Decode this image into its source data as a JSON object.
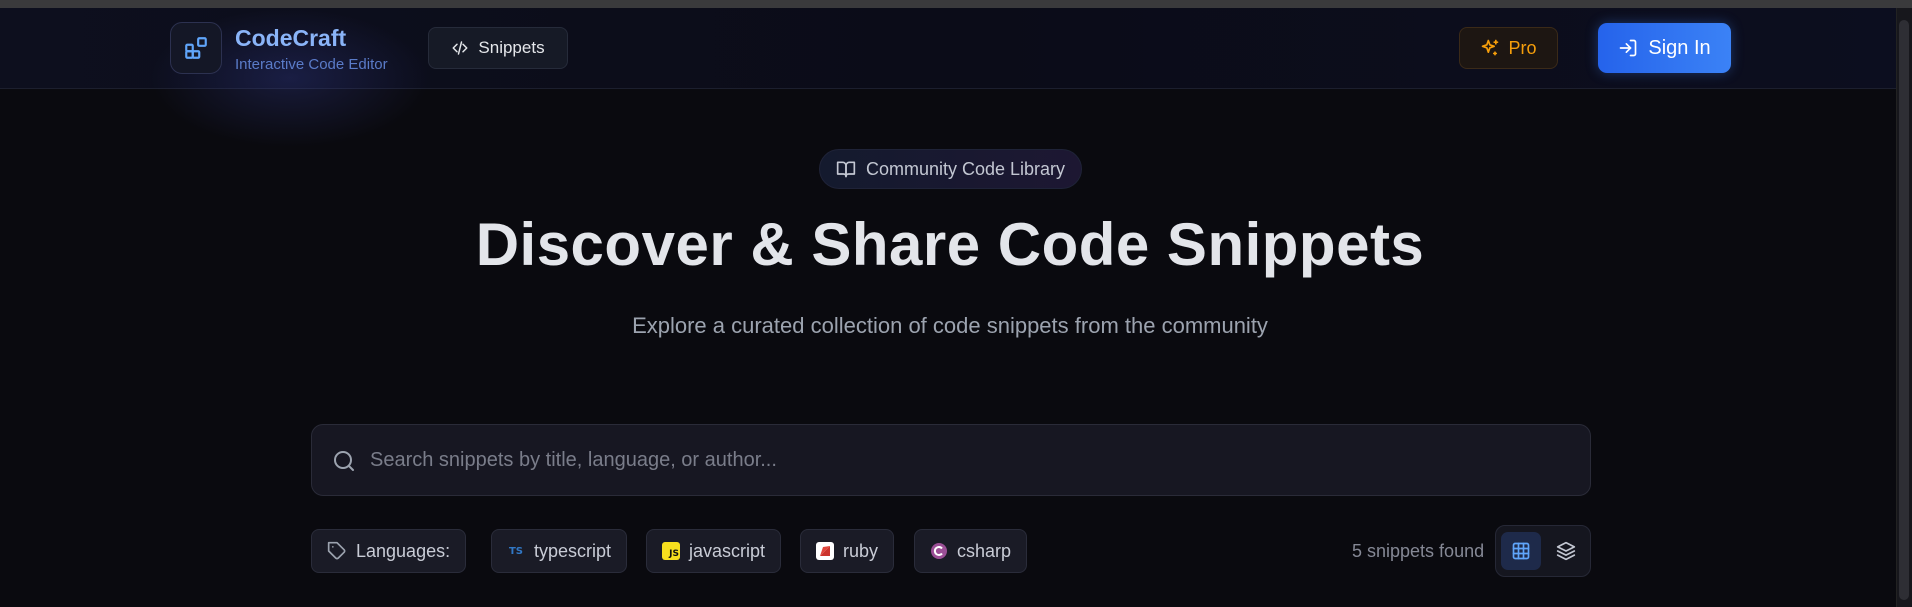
{
  "header": {
    "brand_name": "CodeCraft",
    "brand_tagline": "Interactive Code Editor",
    "nav_snippets_label": "Snippets",
    "pro_label": "Pro",
    "signin_label": "Sign In"
  },
  "hero": {
    "badge_label": "Community Code Library",
    "title": "Discover & Share Code Snippets",
    "subtitle": "Explore a curated collection of code snippets from the community"
  },
  "search": {
    "placeholder": "Search snippets by title, language, or author...",
    "value": ""
  },
  "filters": {
    "languages_label": "Languages:",
    "languages": [
      {
        "label": "typescript",
        "icon": "typescript-icon",
        "icon_text": "TS",
        "color": "#3178c6"
      },
      {
        "label": "javascript",
        "icon": "javascript-icon",
        "icon_text": "JS",
        "color": "#f7df1e"
      },
      {
        "label": "ruby",
        "icon": "ruby-icon",
        "color": "#cc342d"
      },
      {
        "label": "csharp",
        "icon": "csharp-icon",
        "color": "#9b4f96"
      }
    ],
    "results_count": "5 snippets found"
  },
  "view_toggle": {
    "options": [
      "grid",
      "layers"
    ],
    "selected": "grid"
  },
  "colors": {
    "background": "#0a0a0f",
    "accent": "#3b82f6",
    "brand": "#8ab4f8",
    "pro": "#f59e0b"
  }
}
